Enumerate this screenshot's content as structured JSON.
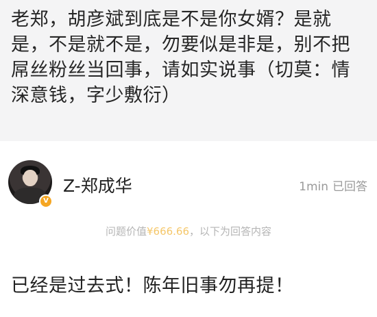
{
  "question": {
    "text": "老郑，胡彦斌到底是不是你女婿？是就是，不是就不是，勿要似是非是，别不把屌丝粉丝当回事，请如实说事（切莫：情深意钱，字少敷衍）"
  },
  "answer": {
    "user_name": "Z-郑成华",
    "time": "1min",
    "status": "已回答",
    "price_prefix": "问题价值",
    "price_value": "¥666.66",
    "price_suffix": "，以下为回答内容",
    "text": "已经是过去式！陈年旧事勿再提！"
  },
  "colors": {
    "question_bg": "#f4f4f5",
    "badge": "#f5a623",
    "price": "#f5c76a"
  }
}
